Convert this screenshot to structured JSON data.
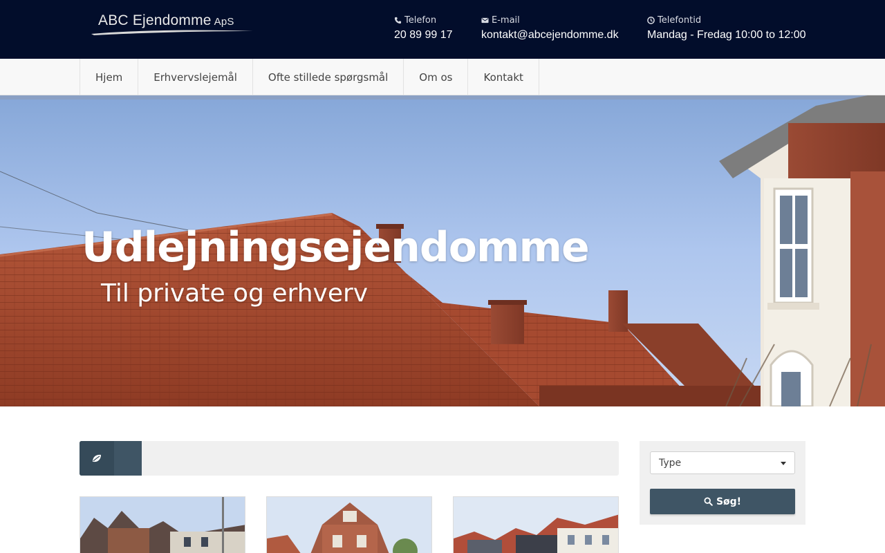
{
  "brand": {
    "name": "ABC Ejendomme",
    "suffix": "ApS"
  },
  "contact": {
    "phone_label": "Telefon",
    "phone_value": "20 89 99 17",
    "email_label": "E-mail",
    "email_value": "kontakt@abcejendomme.dk",
    "hours_label": "Telefontid",
    "hours_value": "Mandag - Fredag 10:00 to 12:00"
  },
  "nav": {
    "items": [
      {
        "label": "Hjem"
      },
      {
        "label": "Erhvervslejemål"
      },
      {
        "label": "Ofte stillede spørgsmål"
      },
      {
        "label": "Om os"
      },
      {
        "label": "Kontakt"
      }
    ]
  },
  "hero": {
    "title": "Udlejningsejendomme",
    "subtitle": "Til private og erhverv"
  },
  "search": {
    "type_select_value": "Type",
    "button_label": "Søg!"
  },
  "icons": {
    "phone": "phone-icon",
    "email": "envelope-icon",
    "hours": "clock-icon",
    "filter": "leaf-icon",
    "search": "search-icon",
    "select": "caret-down-icon"
  },
  "colors": {
    "header_bg": "#020d2b",
    "accent": "#3f5565",
    "panel_bg": "#f0f0f0",
    "nav_bg": "#f8f8f8"
  }
}
